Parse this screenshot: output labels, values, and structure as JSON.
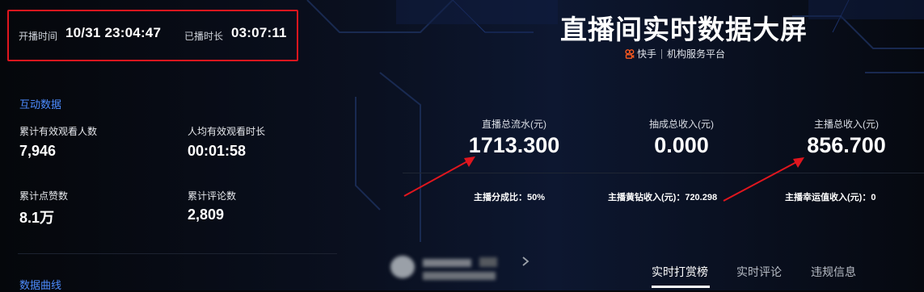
{
  "live_info": {
    "start_label": "开播时间",
    "start_value": "10/31 23:04:47",
    "duration_label": "已播时长",
    "duration_value": "03:07:11"
  },
  "header": {
    "title": "直播间实时数据大屏",
    "brand_name": "快手",
    "platform": "机构服务平台"
  },
  "interaction": {
    "section_title": "互动数据",
    "stats": [
      {
        "label": "累计有效观看人数",
        "value": "7,946"
      },
      {
        "label": "人均有效观看时长",
        "value": "00:01:58"
      },
      {
        "label": "累计点赞数",
        "value": "8.1万"
      },
      {
        "label": "累计评论数",
        "value": "2,809"
      }
    ]
  },
  "curve": {
    "section_title": "数据曲线"
  },
  "revenue": {
    "kpis": [
      {
        "label": "直播总流水(元)",
        "value": "1713.300"
      },
      {
        "label": "抽成总收入(元)",
        "value": "0.000"
      },
      {
        "label": "主播总收入(元)",
        "value": "856.700"
      }
    ],
    "sub_stats": [
      {
        "text": "主播分成比：50%"
      },
      {
        "text": "主播黄钻收入(元)：720.298"
      },
      {
        "text": "主播幸运值收入(元)：0"
      }
    ]
  },
  "tabs": [
    {
      "label": "实时打赏榜",
      "active": true
    },
    {
      "label": "实时评论",
      "active": false
    },
    {
      "label": "违规信息",
      "active": false
    }
  ],
  "colors": {
    "accent_blue": "#4d8cff",
    "highlight_red": "#e0161e",
    "brand_orange": "#ff5a1f",
    "background": "#05070b"
  }
}
